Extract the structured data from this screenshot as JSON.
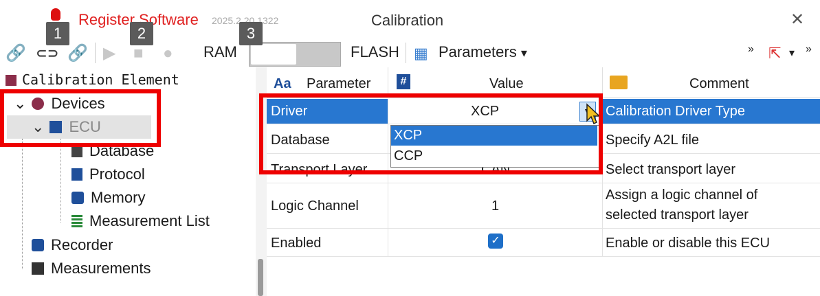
{
  "window": {
    "app_name": "Register Software",
    "version": "2025.2.20.1322",
    "title": "Calibration",
    "close_label": "✕"
  },
  "badges": [
    "1",
    "2",
    "3"
  ],
  "toolbar": {
    "ram_label": "RAM",
    "flash_label": "FLASH",
    "parameters_label": "Parameters",
    "dropdown_arrow": "▾",
    "overflow_label": "»",
    "icons": [
      "link-icon",
      "connect-icon",
      "disconnect-icon",
      "play-icon",
      "stop-icon",
      "record-icon",
      "parameters-icon",
      "export-icon"
    ]
  },
  "tree": {
    "header": "Calibration Element",
    "items": [
      {
        "label": "Devices",
        "expander": "⌄"
      },
      {
        "label": "ECU",
        "expander": "⌄"
      },
      {
        "label": "Database"
      },
      {
        "label": "Protocol"
      },
      {
        "label": "Memory"
      },
      {
        "label": "Measurement List"
      },
      {
        "label": "Recorder"
      },
      {
        "label": "Measurements"
      }
    ]
  },
  "grid": {
    "headers": {
      "parameter": "Parameter",
      "value": "Value",
      "comment": "Comment",
      "parameter_icon": "Aa",
      "value_icon": "#"
    },
    "rows": [
      {
        "parameter": "Driver",
        "value": "XCP",
        "comment": "Calibration Driver Type"
      },
      {
        "parameter": "Database",
        "value": "",
        "comment": "Specify A2L file"
      },
      {
        "parameter": "Transport Layer",
        "value": "CAN",
        "comment": "Select transport layer"
      },
      {
        "parameter": "Logic Channel",
        "value": "1",
        "comment_line1": "Assign a logic channel of",
        "comment_line2": "selected transport layer"
      },
      {
        "parameter": "Enabled",
        "value": "✓",
        "comment": "Enable or disable this ECU"
      }
    ],
    "dropdown_options": [
      "XCP",
      "CCP"
    ],
    "selected_option": "XCP"
  },
  "colors": {
    "accent": "#2877d0",
    "highlight": "#e00000",
    "app_name": "#e02020"
  }
}
